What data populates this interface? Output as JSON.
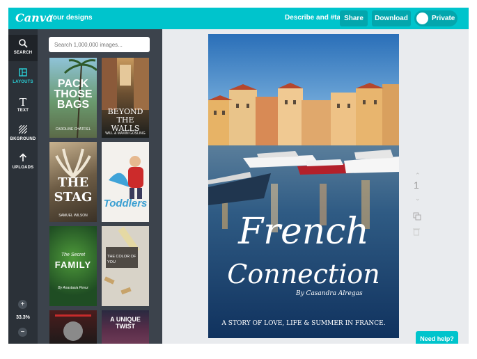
{
  "topbar": {
    "logo": "Canva",
    "your_designs": "Your designs",
    "describe": "Describe and #tag",
    "share": "Share",
    "download": "Download",
    "privacy": "Private",
    "color": "#00c4cc"
  },
  "sidebar": {
    "items": [
      {
        "label": "SEARCH",
        "icon": "search-icon"
      },
      {
        "label": "LAYOUTS",
        "icon": "layouts-icon"
      },
      {
        "label": "TEXT",
        "icon": "text-icon"
      },
      {
        "label": "BKGROUND",
        "icon": "background-icon"
      },
      {
        "label": "UPLOADS",
        "icon": "uploads-icon"
      }
    ],
    "zoom_in": "+",
    "zoom_level": "33.3%",
    "zoom_out": "−"
  },
  "panel": {
    "search_placeholder": "Search 1,000,000 images...",
    "thumbs": [
      {
        "line1": "PACK THOSE BAGS",
        "line2": "CAROLINE CHATFIEL"
      },
      {
        "line1": "BEYOND THE WALLS",
        "line2": "WILL & MAXIN GOSLING"
      },
      {
        "line1": "THE STAG",
        "line2": "SAMUEL WILSON"
      },
      {
        "line1": "Toddlers",
        "line2": ""
      },
      {
        "line1": "FAMILY",
        "line2": "The Secret",
        "line3": "By Anastasia Perez"
      },
      {
        "line1": "THE COLOR OF YOU",
        "line2": ""
      },
      {
        "line1": "",
        "line2": ""
      },
      {
        "line1": "A UNIQUE TWIST",
        "line2": ""
      }
    ]
  },
  "design": {
    "title_line1": "French",
    "title_line2": "Connection",
    "author": "By Casandra Alregas",
    "tagline": "A STORY OF LOVE, LIFE & SUMMER IN FRANCE."
  },
  "canvas": {
    "page_number": "1",
    "help": "Need help?"
  }
}
